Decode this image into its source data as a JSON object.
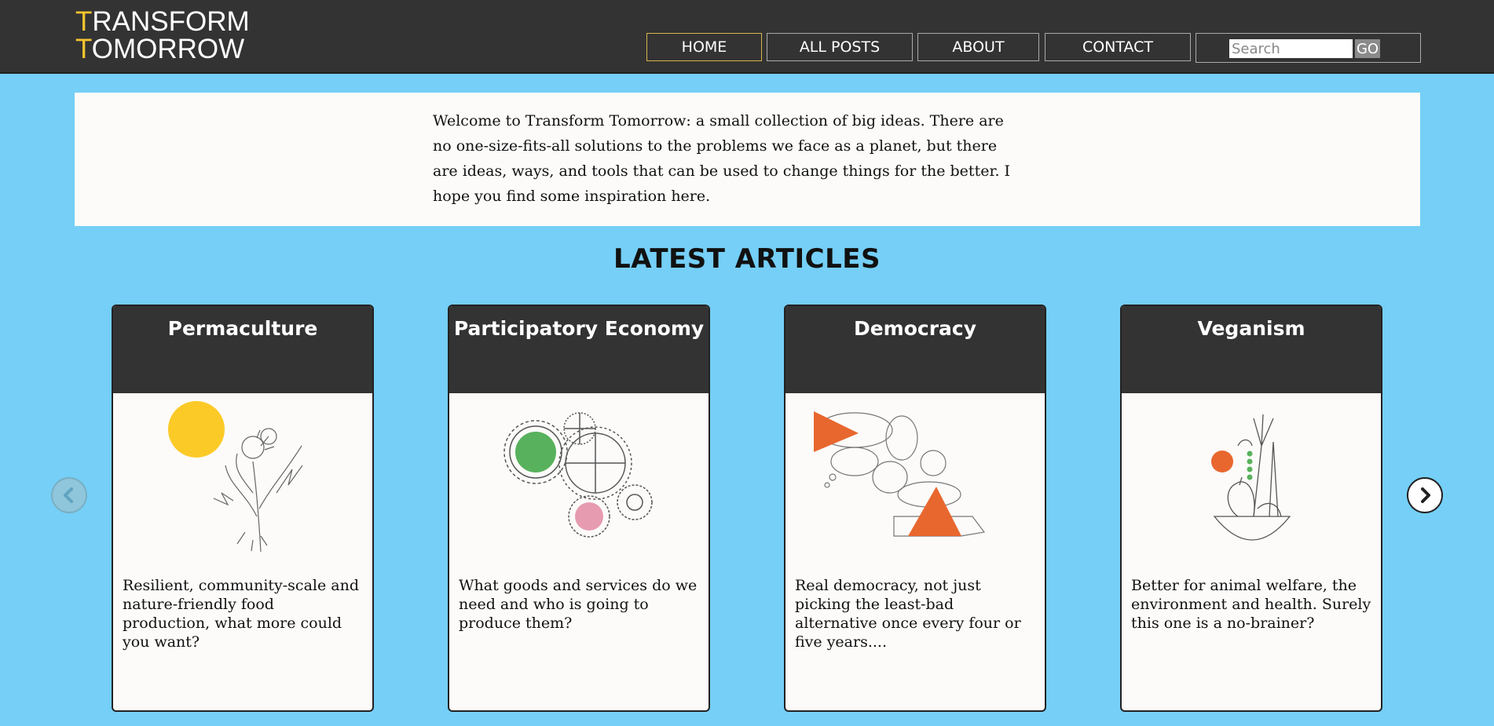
{
  "header": {
    "logo": {
      "line1_cap": "T",
      "line1_rest": "RANSFORM",
      "line2_cap": "T",
      "line2_rest": "OMORROW"
    },
    "nav": [
      "HOME",
      "ALL POSTS",
      "ABOUT",
      "CONTACT"
    ],
    "active_nav": "HOME",
    "search": {
      "placeholder": "Search",
      "button_label": "GO"
    }
  },
  "intro": {
    "text": "Welcome to Transform Tomorrow: a small collection of big ideas. There are no one-size-fits-all solutions to the problems we face as a planet, but there are ideas, ways, and tools that can be used to change things for the better. I hope you find some inspiration here."
  },
  "latest": {
    "title": "LATEST ARTICLES",
    "cards": [
      {
        "title": "Permaculture",
        "description": "Resilient, community-scale and nature-friendly food production, what more could you want?",
        "image_icon": "dandelion-illustration-icon"
      },
      {
        "title": "Participatory Economy",
        "description": "What goods and services do we need and who is going to produce them?",
        "image_icon": "gears-illustration-icon"
      },
      {
        "title": "Democracy",
        "description": "Real democracy, not just picking the least-bad alternative once every four or five years....",
        "image_icon": "speech-bubbles-illustration-icon"
      },
      {
        "title": "Veganism",
        "description": "Better for animal welfare, the environment and health. Surely this one is a no-brainer?",
        "image_icon": "vegetable-bowl-illustration-icon"
      }
    ]
  },
  "colors": {
    "background": "#75cff6",
    "header": "#333333",
    "accent": "#f7c52f",
    "card_bg": "#fcfbf9"
  }
}
